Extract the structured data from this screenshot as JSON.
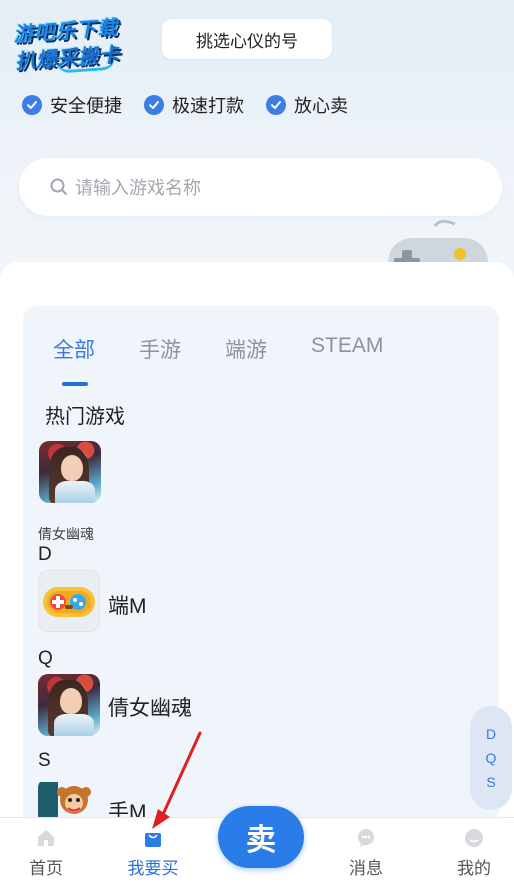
{
  "header": {
    "logo_line1": "游吧乐下载",
    "logo_line2": "扒爆采搬卡",
    "title": "挑选心仪的号",
    "features": [
      {
        "label": "安全便捷",
        "icon": "check-circle-icon"
      },
      {
        "label": "极速打款",
        "icon": "check-circle-icon"
      },
      {
        "label": "放心卖",
        "icon": "check-circle-icon"
      }
    ]
  },
  "search": {
    "placeholder": "请输入游戏名称"
  },
  "tabs": [
    {
      "label": "全部",
      "active": true
    },
    {
      "label": "手游",
      "active": false
    },
    {
      "label": "端游",
      "active": false
    },
    {
      "label": "STEAM",
      "active": false
    }
  ],
  "hot_section": {
    "title": "热门游戏",
    "hot_game_name": "倩女幽魂"
  },
  "groups": [
    {
      "letter": "D",
      "game": "端M",
      "icon": "gamepad-icon"
    },
    {
      "letter": "Q",
      "game": "倩女幽魂",
      "icon": "heroine-icon"
    },
    {
      "letter": "S",
      "game": "手M",
      "icon": "monkey-icon"
    }
  ],
  "index_letters": [
    "D",
    "Q",
    "S"
  ],
  "bottom_nav": {
    "home": "首页",
    "buy": "我要买",
    "sell": "卖",
    "messages": "消息",
    "mine": "我的"
  },
  "colors": {
    "accent": "#2a7de8",
    "tab_active": "#3a7ae0",
    "panel_bg": "#f0f5fc",
    "annotation_arrow": "#e02020"
  }
}
